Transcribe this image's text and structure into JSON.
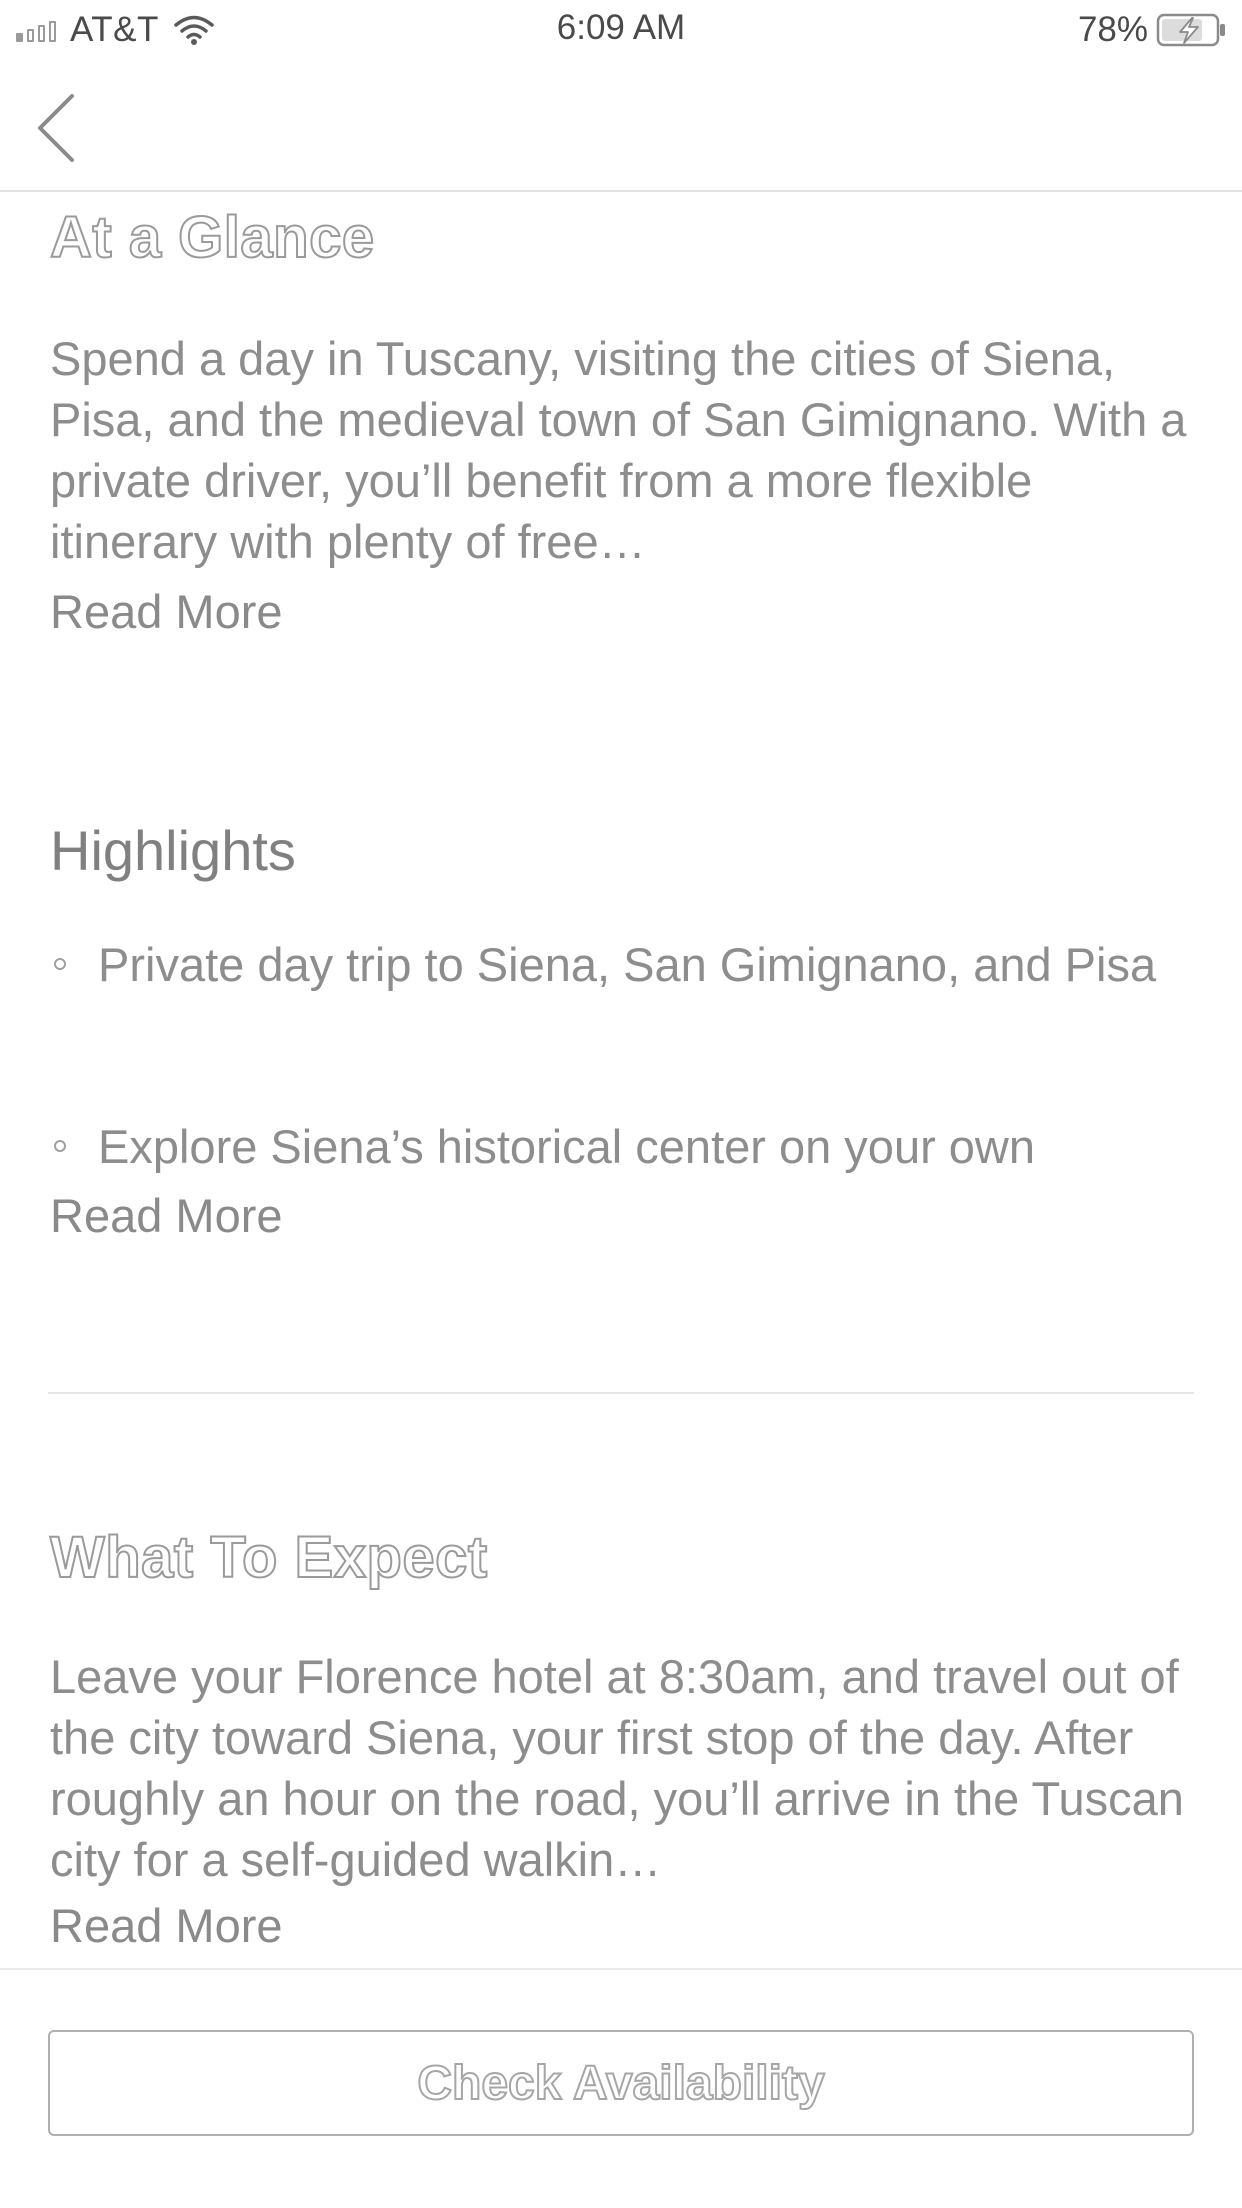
{
  "status_bar": {
    "carrier": "AT&T",
    "time": "6:09 AM",
    "battery": "78%"
  },
  "nav": {
    "back_icon": "chevron-left-icon"
  },
  "at_a_glance": {
    "title": "At a Glance",
    "body": "Spend a day in Tuscany, visiting the cities of Siena, Pisa, and the medieval town of San Gimignano. With a private driver, you’ll benefit from a more flexible itinerary with plenty of free…",
    "read_more": "Read More"
  },
  "highlights": {
    "title": "Highlights",
    "items": [
      "Private day trip to Siena, San Gimignano, and Pisa",
      "Explore Siena’s historical center on your own"
    ],
    "read_more": "Read More"
  },
  "what_to_expect": {
    "title": "What To Expect",
    "body": "Leave your Florence hotel at 8:30am, and travel out of the city toward Siena, your first stop of the day. After roughly an hour on the road, you’ll arrive in the Tuscan city for a self-guided walkin…",
    "read_more": "Read More"
  },
  "footer": {
    "cta_label": "Check Availability"
  },
  "colors": {
    "text_gray": "#8d8d8d",
    "divider": "#e6e6e6",
    "outline": "#9a9a9a"
  }
}
